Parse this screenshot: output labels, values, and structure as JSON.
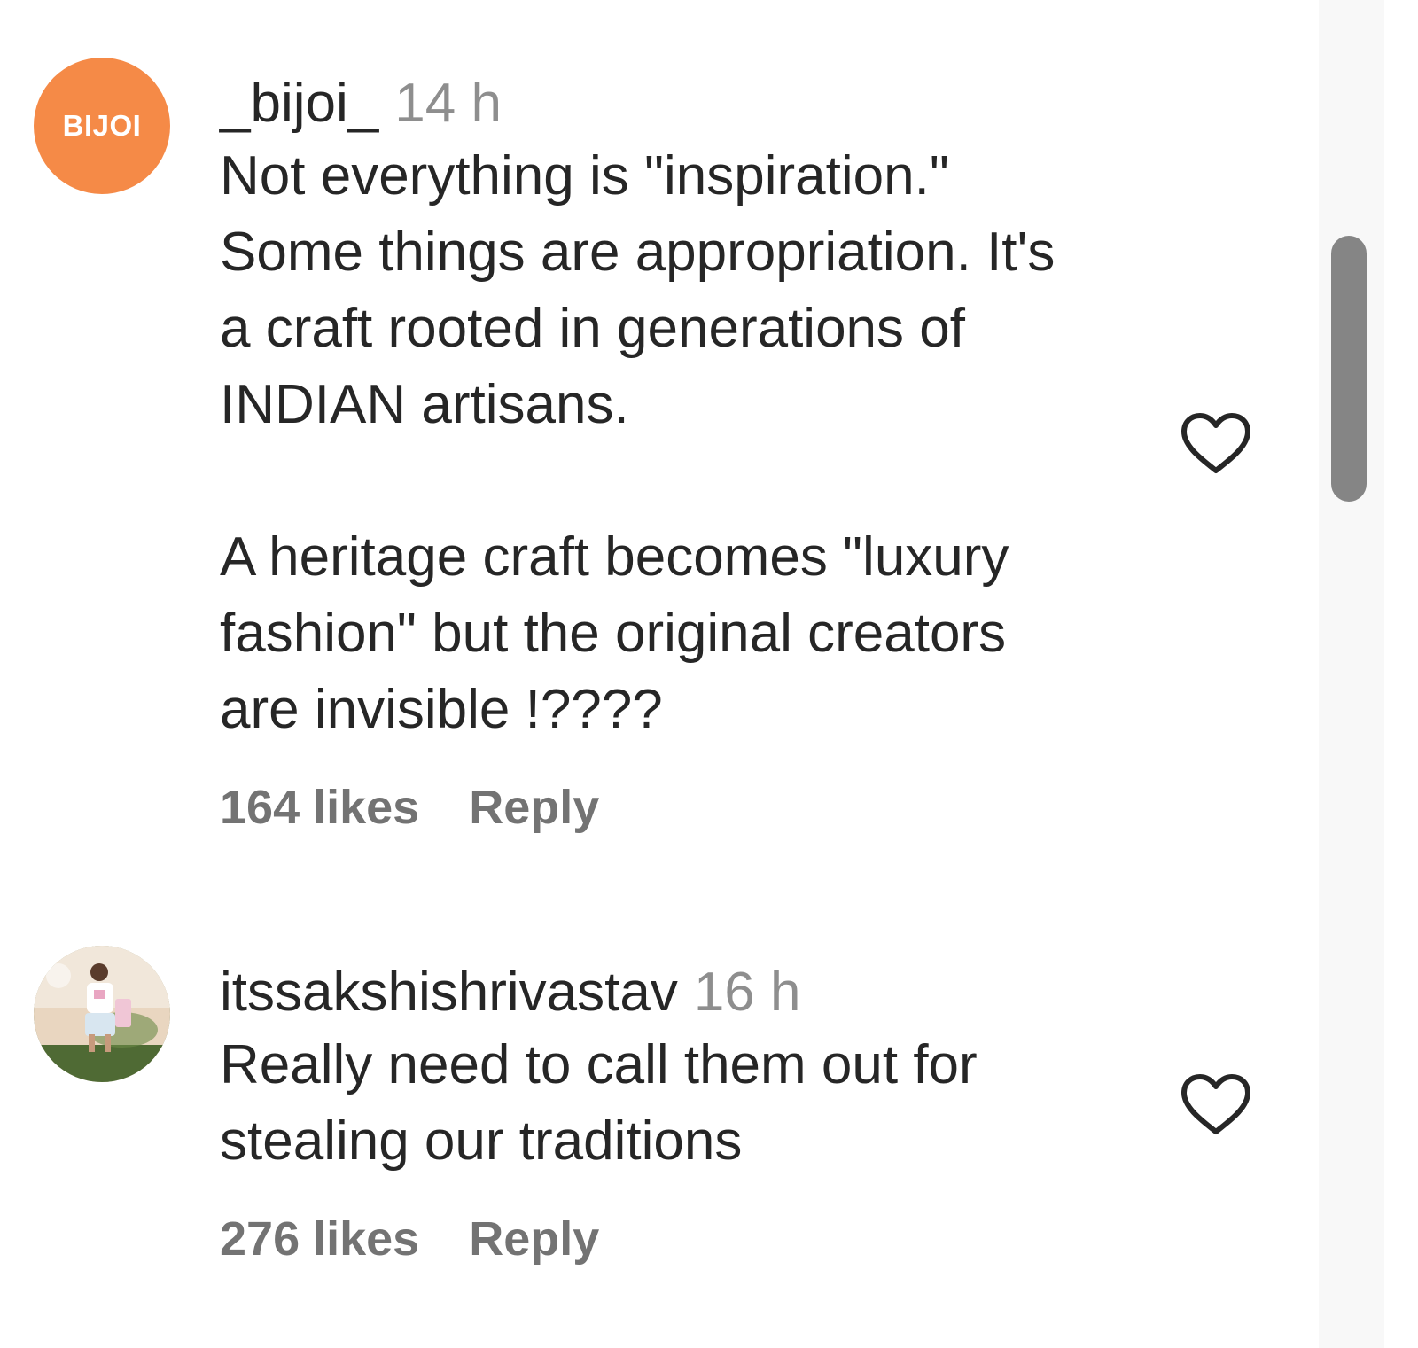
{
  "comments": [
    {
      "avatar_text": "BIJOI",
      "avatar_color": "#f58a47",
      "username": "_bijoi_",
      "time": "14 h",
      "text": "Not everything is \"inspiration.\"\nSome things are appropriation. It's\na craft rooted in generations of\nINDIAN artisans.\n\nA heritage craft becomes \"luxury\nfashion\" but the original creators\nare invisible !????",
      "likes": "164 likes",
      "reply": "Reply",
      "like_icon": "heart-outline-icon"
    },
    {
      "avatar_text": "",
      "username": "itssakshishrivastav",
      "time": "16 h",
      "text": "Really need to call them out for\nstealing our traditions",
      "likes": "276 likes",
      "reply": "Reply",
      "like_icon": "heart-outline-icon"
    }
  ],
  "colors": {
    "text": "#262626",
    "secondary": "#8e8e8e",
    "action": "#737373",
    "scrollbar_thumb": "#858585"
  }
}
